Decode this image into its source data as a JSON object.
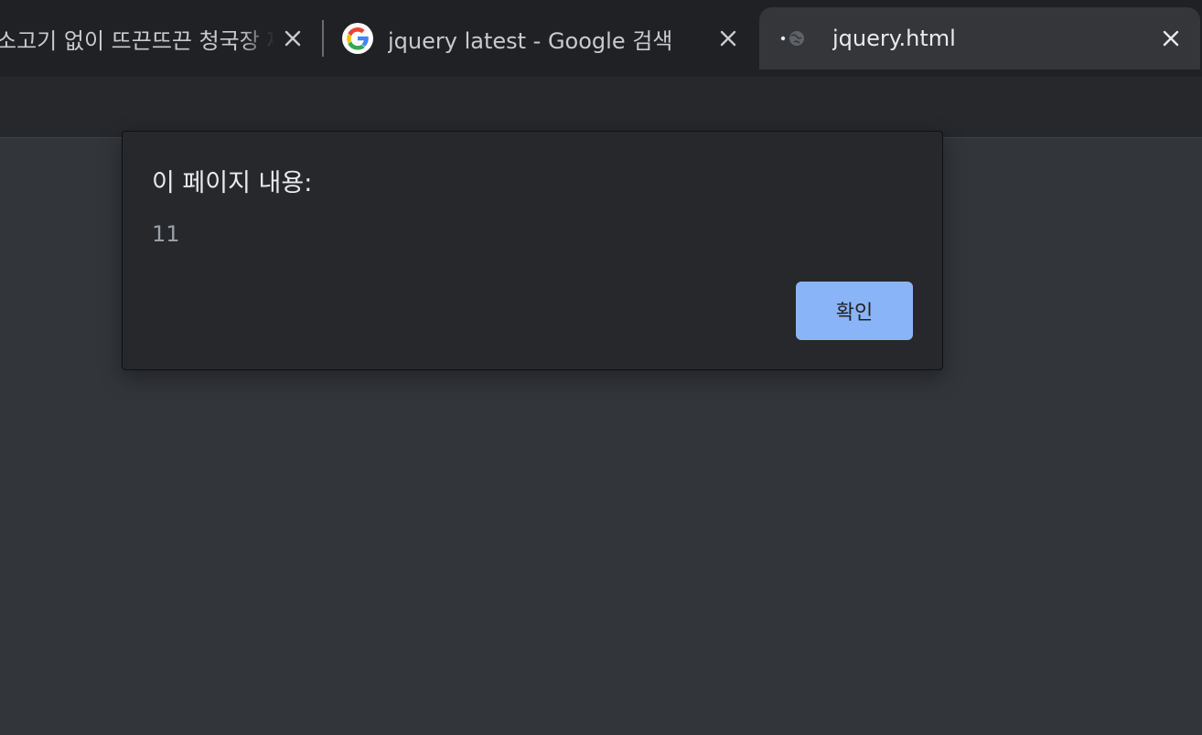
{
  "tabs": [
    {
      "title": "소고기 없이 뜨끈뜨끈 청국장 찌개",
      "favicon": "none",
      "close_icon": "close-icon"
    },
    {
      "title": "jquery latest - Google 검색",
      "favicon": "google-g-icon",
      "close_icon": "close-icon"
    },
    {
      "title": "jquery.html",
      "favicon": "globe-icon",
      "close_icon": "close-icon",
      "active": true
    }
  ],
  "dialog": {
    "title": "이 페이지 내용:",
    "message": "11",
    "ok_label": "확인"
  },
  "colors": {
    "accent": "#8ab4f8",
    "background": "#32353a",
    "dialog_background": "#27282c",
    "tabstrip": "#202124"
  }
}
